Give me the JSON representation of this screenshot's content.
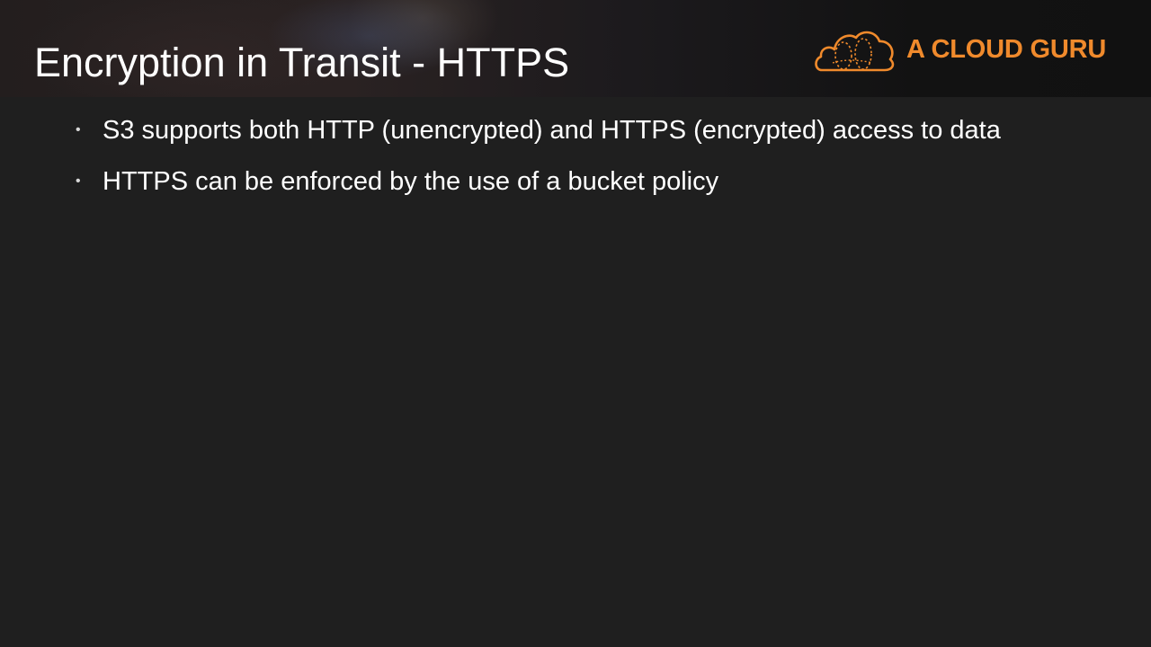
{
  "slide": {
    "title": "Encryption in Transit - HTTPS",
    "logo": {
      "text": "A CLOUD GURU",
      "icon": "cloud-icon",
      "color": "#f08a2c"
    },
    "bullets": [
      {
        "marker": "•",
        "text": "S3 supports both HTTP (unencrypted) and HTTPS (encrypted) access to data"
      },
      {
        "marker": "•",
        "text": "HTTPS can be enforced by the use of a bucket policy"
      }
    ],
    "colors": {
      "background": "#1f1f1f",
      "text": "#ffffff",
      "accent": "#f08a2c"
    }
  }
}
